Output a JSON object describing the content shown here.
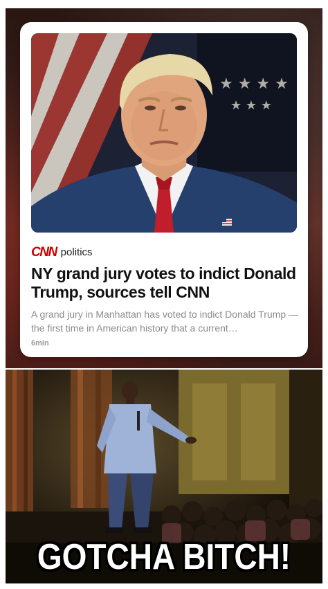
{
  "news_card": {
    "brand_logo": "CNN",
    "section": "politics",
    "headline": "NY grand jury votes to indict Donald Trump, sources tell CNN",
    "summary": "A grand jury in Manhattan has voted to indict Donald Trump — the first time in American history that a current…",
    "timestamp": "6min",
    "brand_color": "#cc0000"
  },
  "meme": {
    "caption": "GOTCHA BITCH!"
  }
}
